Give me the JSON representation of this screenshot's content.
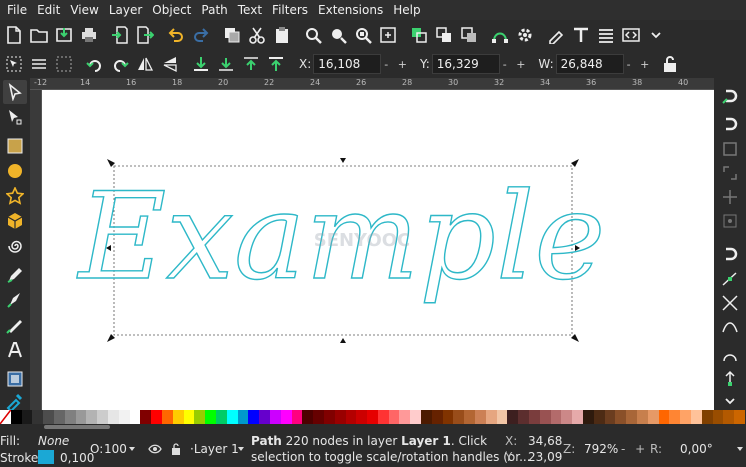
{
  "menu": [
    "File",
    "Edit",
    "View",
    "Layer",
    "Object",
    "Path",
    "Text",
    "Filters",
    "Extensions",
    "Help"
  ],
  "controls": {
    "x_label": "X:",
    "x_value": "16,108",
    "y_label": "Y:",
    "y_value": "16,329",
    "w_label": "W:",
    "w_value": "26,848",
    "spin": "- +"
  },
  "ruler": {
    "ticks": [
      "-12",
      "14",
      "16",
      "18",
      "20",
      "22",
      "24",
      "26",
      "28",
      "30",
      "32",
      "34",
      "36",
      "38",
      "40"
    ]
  },
  "canvas": {
    "text": "Example",
    "watermark": "SENYOOC",
    "stroke_color": "#2eb8c8"
  },
  "palette": [
    "#ffffff",
    "#000000",
    "#1a1a1a",
    "#333333",
    "#4d4d4d",
    "#666666",
    "#808080",
    "#999999",
    "#b3b3b3",
    "#cccccc",
    "#e6e6e6",
    "#f2f2f2",
    "#ffffff",
    "#800000",
    "#ff0000",
    "#ff6600",
    "#ffcc00",
    "#ffff00",
    "#99cc00",
    "#00ff00",
    "#00cc66",
    "#00ffff",
    "#0099cc",
    "#0000ff",
    "#6600cc",
    "#cc00ff",
    "#ff00ff",
    "#ff0080",
    "#4d0000",
    "#660000",
    "#800000",
    "#990000",
    "#b30000",
    "#cc0000",
    "#e60000",
    "#ff3333",
    "#ff6666",
    "#ff9999",
    "#ffcccc",
    "#4d1a00",
    "#662200",
    "#803300",
    "#994d1a",
    "#b36633",
    "#cc8055",
    "#e6a680",
    "#f2c6a6",
    "#3d1f1f",
    "#5c2e2e",
    "#7a3d3d",
    "#995252",
    "#b36b6b",
    "#cc8888",
    "#e6aaaa",
    "#2e1a0d",
    "#4d2b14",
    "#6b3d1f",
    "#8a5029",
    "#a86638",
    "#c77f4d",
    "#e69966",
    "#ff6600",
    "#ff8533",
    "#ffa366",
    "#ffc299",
    "#804000",
    "#994d00",
    "#b35900",
    "#cc6600"
  ],
  "status": {
    "fill_label": "Fill:",
    "fill_value": "None",
    "stroke_label": "Stroke:",
    "stroke_width": "0,100",
    "stroke_color": "#1ba8d5",
    "opacity_label": "O:",
    "opacity_value": "100",
    "layer": "·Layer 1",
    "msg_prefix": "Path",
    "msg_mid": " 220 nodes in layer ",
    "msg_layer": "Layer 1",
    "msg_rest": ". Click",
    "msg_line2": "selection to toggle scale/rotation handles (or...",
    "x_label": "X:",
    "x_value": "34,68",
    "y_label": "Y:",
    "y_value": "23,09",
    "z_label": "Z:",
    "zoom": "792%",
    "r_label": "R:",
    "rotation": "0,00°"
  }
}
